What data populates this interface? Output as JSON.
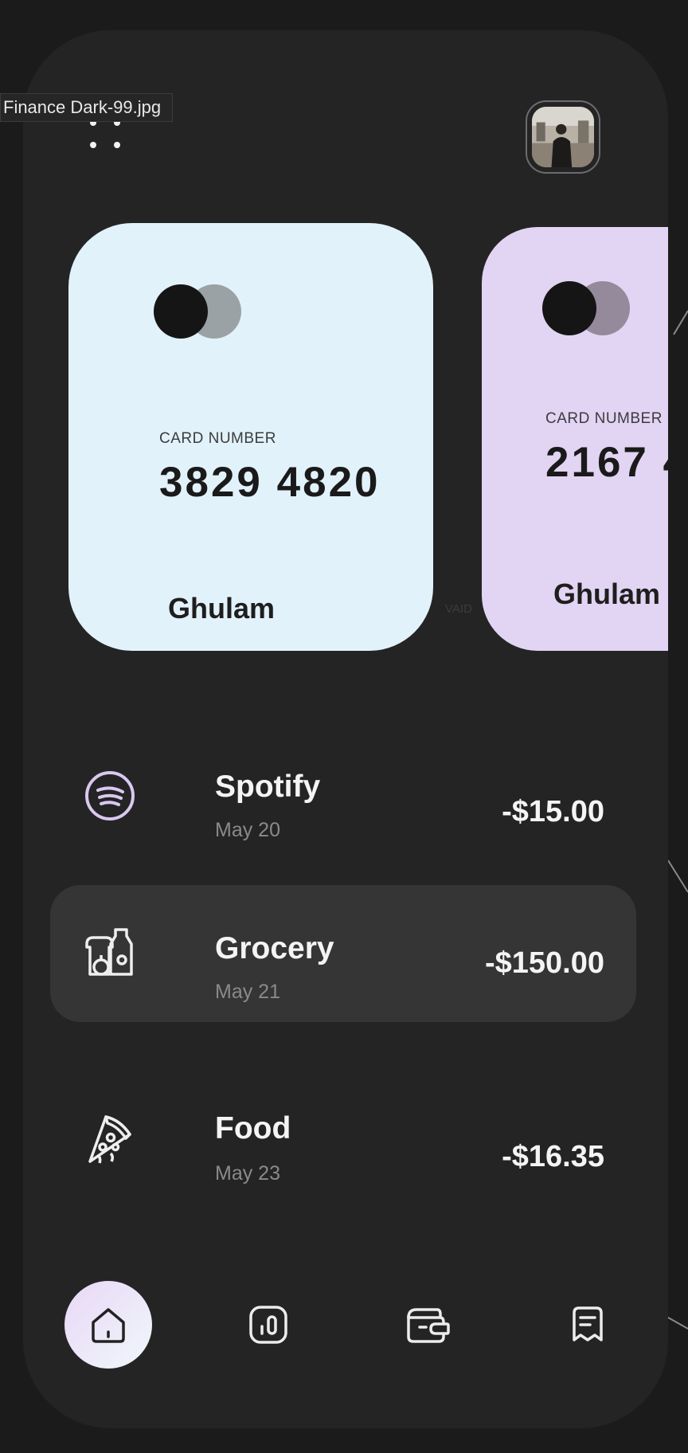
{
  "window": {
    "filename": "Finance Dark-99.jpg"
  },
  "header": {
    "menu_icon": "dots-menu-icon",
    "avatar_icon": "profile-avatar"
  },
  "cards": [
    {
      "label": "CARD NUMBER",
      "number": "3829 4820",
      "holder": "Ghulam",
      "color": "#e2f2fa",
      "logo_secondary_color": "#9aa2a6"
    },
    {
      "label": "CARD NUMBER",
      "number": "2167 4",
      "holder": "Ghulam",
      "color": "#e2d4f3",
      "logo_secondary_color": "#958a9c"
    }
  ],
  "card_extra": {
    "valid_label": "VAID"
  },
  "transactions": [
    {
      "name": "Spotify",
      "date": "May 20",
      "amount": "-$15.00",
      "icon": "spotify-icon",
      "highlighted": false
    },
    {
      "name": "Grocery",
      "date": "May 21",
      "amount": "-$150.00",
      "icon": "grocery-icon",
      "highlighted": true
    },
    {
      "name": "Food",
      "date": "May 23",
      "amount": "-$16.35",
      "icon": "pizza-icon",
      "highlighted": false
    }
  ],
  "bottom_nav": [
    {
      "icon": "home-icon",
      "active": true
    },
    {
      "icon": "stats-icon",
      "active": false
    },
    {
      "icon": "wallet-icon",
      "active": false
    },
    {
      "icon": "receipt-icon",
      "active": false
    }
  ],
  "theme": {
    "background": "#1b1b1c",
    "phone": "#242425",
    "highlight_row": "#353536",
    "spotify_accent": "#d9c8f0"
  }
}
